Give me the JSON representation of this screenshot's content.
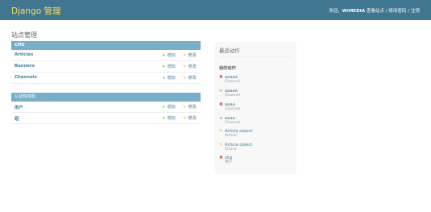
{
  "header": {
    "site_title": "Django 管理",
    "welcome": "欢迎，",
    "username": "WIMEDIA",
    "view_site": "查看站点",
    "sep1": " / ",
    "change_password": "修改密码",
    "sep2": " / ",
    "logout": "注销"
  },
  "page": {
    "title": "站点管理"
  },
  "apps": [
    {
      "name": "CMS",
      "models": [
        {
          "name": "Articles",
          "add": "增加",
          "change": "修改"
        },
        {
          "name": "Banners",
          "add": "增加",
          "change": "修改"
        },
        {
          "name": "Channels",
          "add": "增加",
          "change": "修改"
        }
      ]
    },
    {
      "name": "认证和授权",
      "models": [
        {
          "name": "用户",
          "add": "增加",
          "change": "修改"
        },
        {
          "name": "组",
          "add": "增加",
          "change": "修改"
        }
      ]
    }
  ],
  "recent": {
    "title": "最近动作",
    "subtitle": "我的动作",
    "items": [
      {
        "type": "delete",
        "icon": "delete-icon",
        "title": "aaaaa",
        "model": "Channel"
      },
      {
        "type": "add",
        "icon": "add-icon",
        "title": "aaaaa",
        "model": "Channel"
      },
      {
        "type": "delete",
        "icon": "delete-icon",
        "title": "aaaa",
        "model": "Channel"
      },
      {
        "type": "add",
        "icon": "add-icon",
        "title": "aaaa",
        "model": "Channel"
      },
      {
        "type": "change",
        "icon": "edit-icon",
        "title": "Article object",
        "model": "Article"
      },
      {
        "type": "change",
        "icon": "edit-icon",
        "title": "Article object",
        "model": "Article"
      },
      {
        "type": "delete",
        "icon": "delete-icon",
        "title": "zkg",
        "model": "用户"
      }
    ]
  },
  "colors": {
    "header_bg": "#417690",
    "title_yellow": "#f5dd5d",
    "caption_bg": "#79aec8",
    "link": "#447e9b",
    "add_green": "#70bf2b",
    "change_yellow": "#efb80b",
    "delete_red": "#dd4646"
  }
}
